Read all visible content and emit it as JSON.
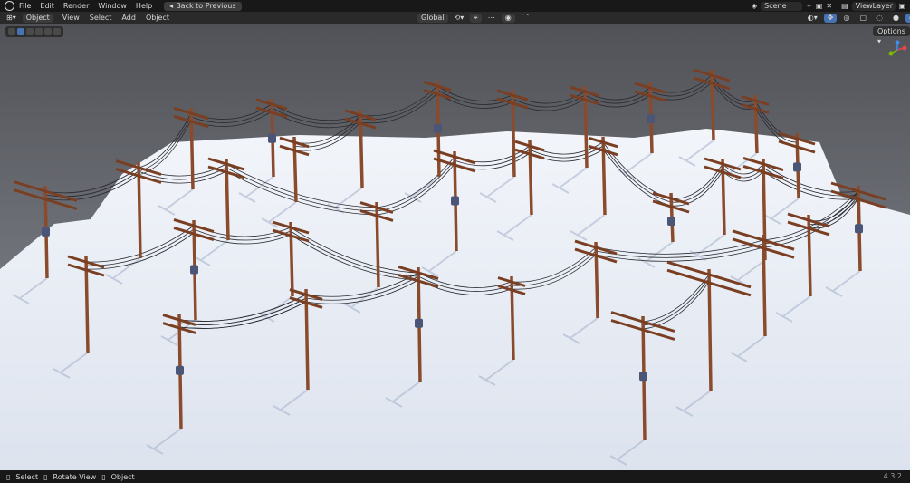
{
  "menu": {
    "items": [
      "File",
      "Edit",
      "Render",
      "Window",
      "Help"
    ],
    "back_button": "Back to Previous"
  },
  "scene": {
    "name": "Scene",
    "view_layer": "ViewLayer"
  },
  "header": {
    "mode": "Object Mode",
    "view": "View",
    "select": "Select",
    "add": "Add",
    "object": "Object",
    "transform": "Global"
  },
  "viewport": {
    "options": "Options"
  },
  "status": {
    "select": "Select",
    "rotate": "Rotate View",
    "object": "Object",
    "version": "4.3.2"
  },
  "colors": {
    "accent": "#4772b3",
    "snow": "#e8edf5",
    "sky_top": "#55575d",
    "sky_bottom": "#8a8d96",
    "pole": "#8a4b2c"
  }
}
